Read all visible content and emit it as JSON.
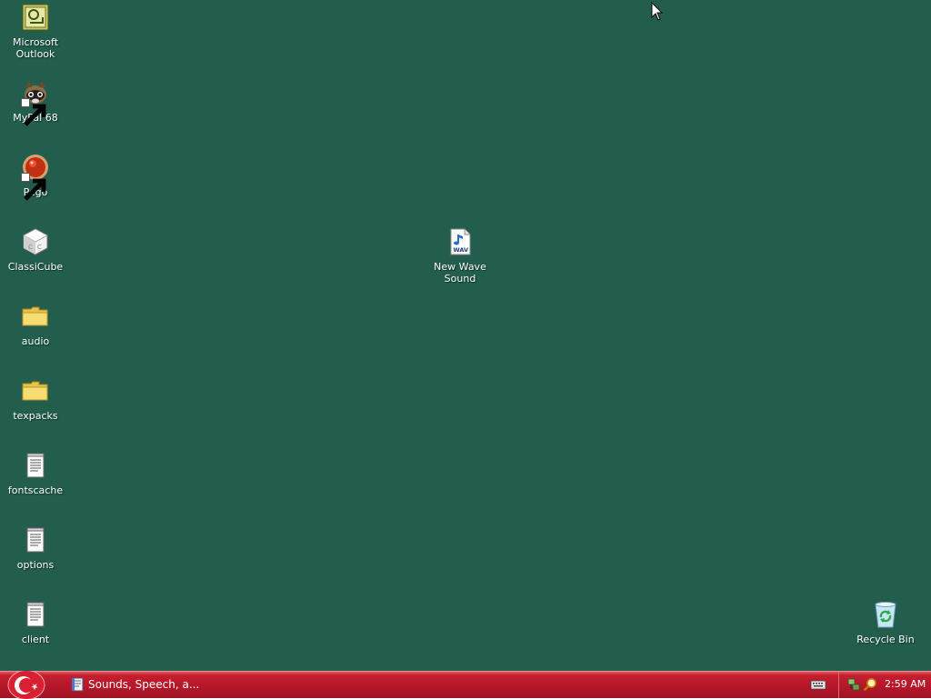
{
  "desktop": {
    "background_color": "#235e4c",
    "icons": [
      {
        "label": "Microsoft Outlook",
        "icon": "outlook-icon",
        "shortcut": false
      },
      {
        "label": "MyPal 68",
        "icon": "mypal-raccoon-icon",
        "shortcut": true
      },
      {
        "label": "Pego",
        "icon": "pego-red-ball-icon",
        "shortcut": true
      },
      {
        "label": "ClassiCube",
        "icon": "classicube-cube-icon",
        "shortcut": false
      },
      {
        "label": "audio",
        "icon": "folder-icon",
        "shortcut": false
      },
      {
        "label": "texpacks",
        "icon": "folder-icon",
        "shortcut": false
      },
      {
        "label": "fontscache",
        "icon": "text-document-icon",
        "shortcut": false
      },
      {
        "label": "options",
        "icon": "text-document-icon",
        "shortcut": false
      },
      {
        "label": "client",
        "icon": "text-document-icon",
        "shortcut": false
      },
      {
        "label": "New Wave Sound",
        "icon": "wav-file-icon",
        "shortcut": false
      },
      {
        "label": "Recycle Bin",
        "icon": "recycle-bin-icon",
        "shortcut": false
      }
    ]
  },
  "taskbar": {
    "color": "#b5172a",
    "start_icon": "start-crescent-star-icon",
    "tasks": [
      {
        "label": "Sounds, Speech, a...",
        "icon": "control-panel-icon"
      }
    ],
    "tray": {
      "icons": [
        "keyboard-icon",
        "network-icon",
        "search-icon"
      ],
      "clock": "2:59 AM"
    }
  }
}
